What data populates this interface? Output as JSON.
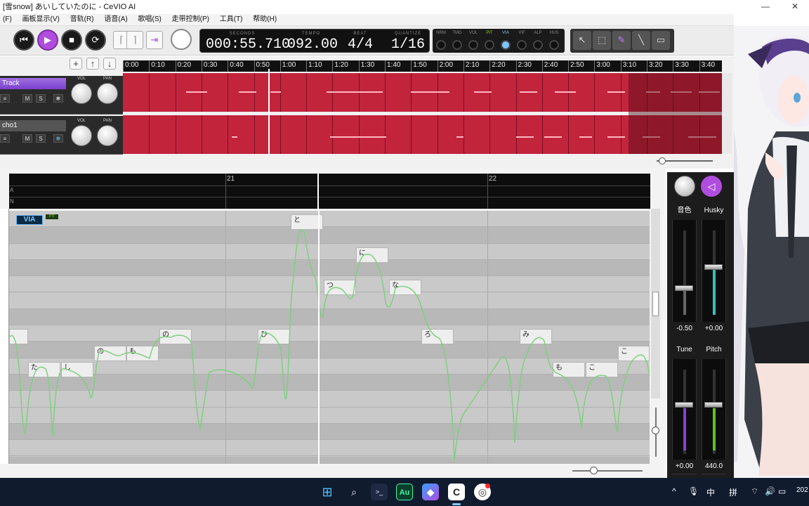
{
  "window": {
    "title": "[雪snow] あいしていたのに - CeVIO AI",
    "minimize": "—",
    "close": "✕"
  },
  "menu": [
    "(F)",
    "画板显示(V)",
    "音轨(R)",
    "语音(A)",
    "歌唱(S)",
    "走带控制(P)",
    "工具(T)",
    "帮助(H)"
  ],
  "toolbar": {
    "display": [
      {
        "label": "SECONDS",
        "value": "000:55.710"
      },
      {
        "label": "TEMPO",
        "value": "092.00"
      },
      {
        "label": "BEAT",
        "value": "4/4"
      },
      {
        "label": "QUANTIZE",
        "value": "1/16"
      }
    ],
    "effects": [
      "NRM",
      "TMG",
      "VOL",
      "PIT",
      "VIA",
      "VIF",
      "ALP",
      "HUS"
    ],
    "active_effects": [
      "PIT",
      "VIA"
    ],
    "icons": [
      "skip-back-icon",
      "play-icon",
      "stop-icon",
      "loop-icon",
      "pitch-snap-icon",
      "arrow-tool-icon",
      "select-tool-icon",
      "pen-tool-icon",
      "line-tool-icon",
      "eraser-tool-icon"
    ]
  },
  "timeline": {
    "ticks": [
      "0:00",
      "0:10",
      "0:20",
      "0:30",
      "0:40",
      "0:50",
      "1:00",
      "1:10",
      "1:20",
      "1:30",
      "1:40",
      "1:50",
      "2:00",
      "2:10",
      "2:20",
      "2:30",
      "2:40",
      "2:50",
      "3:00",
      "3:10",
      "3:20",
      "3:30",
      "3:40"
    ],
    "add": "+",
    "up": "↑",
    "down": "↓"
  },
  "tracks": [
    {
      "name": "Track",
      "selected": true,
      "m": "M",
      "s": "S",
      "vol_label": "VOL",
      "pan_label": "PAN"
    },
    {
      "name": "cho1",
      "selected": false,
      "m": "M",
      "s": "S",
      "vol_label": "VOL",
      "pan_label": "PAN"
    }
  ],
  "editor": {
    "measures": [
      "21",
      "22"
    ],
    "rows": [
      "A",
      "N"
    ],
    "via_badge": "VIA",
    "pit_badge": "PIT",
    "lyrics": [
      {
        "text": "と"
      },
      {
        "text": "に"
      },
      {
        "text": "つ"
      },
      {
        "text": "な"
      },
      {
        "text": ""
      },
      {
        "text": "の"
      },
      {
        "text": "ひ"
      },
      {
        "text": "ろ"
      },
      {
        "text": "み"
      },
      {
        "text": "の"
      },
      {
        "text": "も"
      },
      {
        "text": "た"
      },
      {
        "text": "し"
      },
      {
        "text": "こ"
      },
      {
        "text": "も"
      },
      {
        "text": "こ"
      }
    ]
  },
  "mixer": {
    "top": [
      {
        "title": "音色",
        "value": "-0.50"
      },
      {
        "title": "Husky",
        "value": "+0.00"
      }
    ],
    "bottom": [
      {
        "title": "Tune",
        "value": "+0.00"
      },
      {
        "title": "Pitch",
        "value": "440.0"
      }
    ]
  },
  "taskbar": {
    "apps": [
      "windows-start-icon",
      "search-icon",
      "terminal-icon",
      "audition-icon",
      "copilot-icon",
      "cevio-icon",
      "chrome-icon"
    ],
    "audition_label": "Au",
    "tray": [
      "^",
      "中",
      "拼"
    ],
    "clock": "202"
  },
  "colors": {
    "accent": "#b14dde",
    "track_lane": "#c2243c",
    "pitch_curve": "#7fcf7f"
  }
}
